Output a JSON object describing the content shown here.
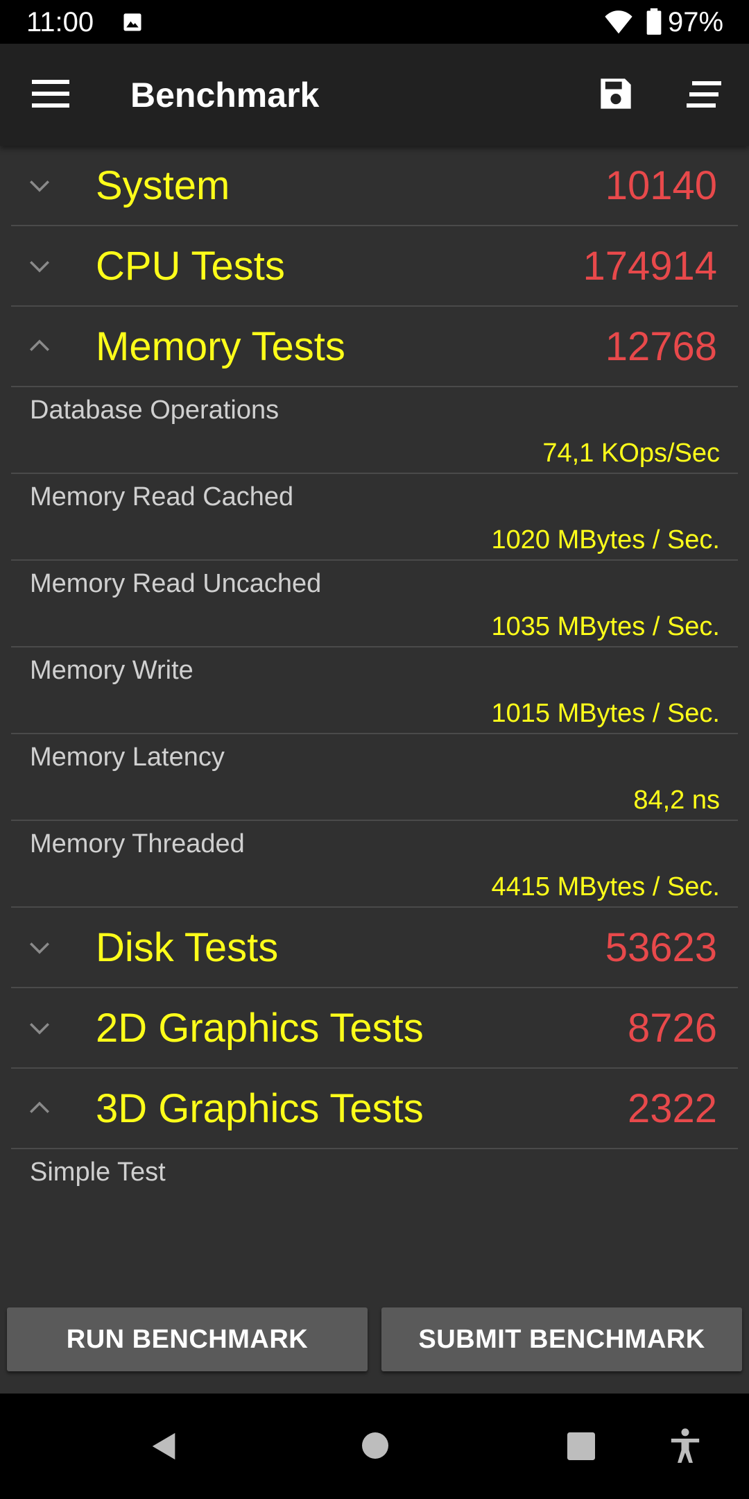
{
  "status_bar": {
    "time": "11:00",
    "battery": "97%",
    "icons": [
      "image-icon",
      "wifi-icon",
      "battery-icon"
    ]
  },
  "app_bar": {
    "title": "Benchmark",
    "icons": [
      "menu-icon",
      "save-icon",
      "sort-icon"
    ]
  },
  "colors": {
    "label_yellow": "#ffff1a",
    "score_red": "#e8494b",
    "background": "#303030",
    "app_bar": "#212121"
  },
  "categories": [
    {
      "label": "System",
      "score": "10140",
      "expanded": false
    },
    {
      "label": "CPU Tests",
      "score": "174914",
      "expanded": false
    },
    {
      "label": "Memory Tests",
      "score": "12768",
      "expanded": true
    },
    {
      "label": "Disk Tests",
      "score": "53623",
      "expanded": false
    },
    {
      "label": "2D Graphics Tests",
      "score": "8726",
      "expanded": false
    },
    {
      "label": "3D Graphics Tests",
      "score": "2322",
      "expanded": true
    }
  ],
  "memory_tests": [
    {
      "label": "Database Operations",
      "value": "74,1 KOps/Sec"
    },
    {
      "label": "Memory Read Cached",
      "value": "1020 MBytes / Sec."
    },
    {
      "label": "Memory Read Uncached",
      "value": "1035 MBytes / Sec."
    },
    {
      "label": "Memory Write",
      "value": "1015 MBytes / Sec."
    },
    {
      "label": "Memory Latency",
      "value": "84,2 ns"
    },
    {
      "label": "Memory Threaded",
      "value": "4415 MBytes / Sec."
    }
  ],
  "graphics_3d_tests": [
    {
      "label": "Simple Test",
      "value": ""
    }
  ],
  "buttons": {
    "run": "RUN BENCHMARK",
    "submit": "SUBMIT BENCHMARK"
  },
  "nav_bar": {
    "icons": [
      "back-icon",
      "home-icon",
      "recents-icon",
      "accessibility-icon"
    ]
  }
}
